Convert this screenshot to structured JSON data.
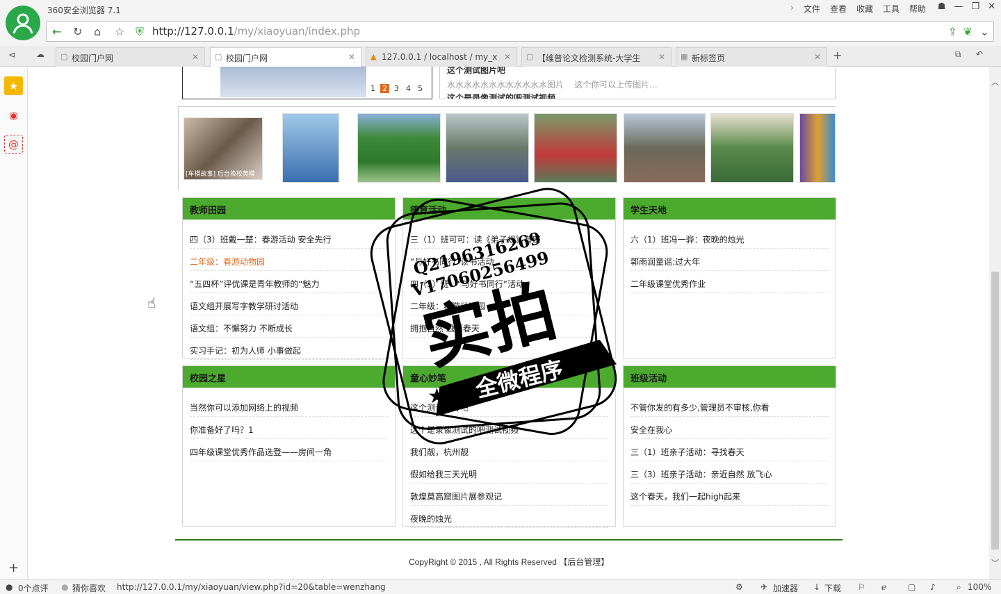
{
  "browser": {
    "title": "360安全浏览器 7.1",
    "menus": [
      "文件",
      "查看",
      "收藏",
      "工具",
      "帮助"
    ],
    "url_host": "http://127.0.0.1",
    "url_path": "/my/xiaoyuan/index.php"
  },
  "tabs": [
    {
      "label": "校园门户网"
    },
    {
      "label": "校园门户网"
    },
    {
      "label": "127.0.0.1 / localhost / my_x"
    },
    {
      "label": "【维普论文检测系统-大学生"
    },
    {
      "label": "新标签页"
    }
  ],
  "top": {
    "pager": [
      "1",
      "2",
      "3",
      "4",
      "5"
    ],
    "pager_active": "2",
    "right_title": "这个测试图片吧",
    "right_desc": "水水水水水水水水水水水水图片",
    "right_desc2": "这个你可以上传图片...",
    "right_title2": "这个是录像测试的吧测试视频"
  },
  "photos": [
    {
      "caption": "[车模故事] 后台换校英模"
    },
    {
      "caption": ""
    },
    {
      "caption": ""
    },
    {
      "caption": ""
    },
    {
      "caption": ""
    },
    {
      "caption": ""
    },
    {
      "caption": ""
    },
    {
      "caption": ""
    }
  ],
  "sections": [
    {
      "title": "教师田园",
      "items": [
        "四（3）班戴一楚：春游活动 安全先行",
        "二年级：春游动物园",
        "“五四杯”评优课是青年教师的“魅力",
        "语文组开展写字教学研讨活动",
        "语文组：不懈努力 不断成长",
        "实习手记：初为人师 小事做起"
      ]
    },
    {
      "title": "德育活动",
      "items": [
        "三（1）班可可：读《弟子规》有感",
        "“与好书同行”读书活动",
        "四（3）班：“与好书同行”活动",
        "二年级：春游动物园",
        "拥抱自然 触摸春天"
      ]
    },
    {
      "title": "学生天地",
      "items": [
        "六（1）班冯一骅：夜晚的烛光",
        "郭雨润童谣:过大年",
        "二年级课堂优秀作业"
      ]
    },
    {
      "title": "校园之星",
      "items": [
        "当然你可以添加网络上的视频",
        "你准备好了吗？1",
        "四年级课堂优秀作品选登——房间一角"
      ]
    },
    {
      "title": "童心妙笔",
      "items": [
        "这个测试图片吧",
        "这个是录像测试的吧测试视频",
        "我们靓，杭州靓",
        "假如给我三天光明",
        "敦煌莫高窟图片展参观记",
        "夜晚的烛光"
      ]
    },
    {
      "title": "班级活动",
      "items": [
        "不管你发的有多少,管理员不审核,你看",
        "安全在我心",
        "三（1）班亲子活动：寻找春天",
        "三（3）班亲子活动：亲近自然 放飞心",
        "这个春天，我们一起high起来"
      ]
    }
  ],
  "footer": {
    "copyright": "CopyRight © 2015 , All Rights Reserved",
    "admin_link": "【后台管理】"
  },
  "stamp": {
    "qq": "Q2196316269",
    "vx": "V17060256499",
    "main": "实拍",
    "sub": "全微程序"
  },
  "status": {
    "comments": "0个点评",
    "guess": "猜你喜欢",
    "link": "http://127.0.0.1/my/xiaoyuan/view.php?id=20&table=wenzhang",
    "accel": "加速器",
    "download": "下载",
    "zoom": "100%"
  },
  "colors": {
    "accent": "#4caa2e",
    "highlight": "#e06a1e",
    "pager_active": "#e06a1e"
  }
}
